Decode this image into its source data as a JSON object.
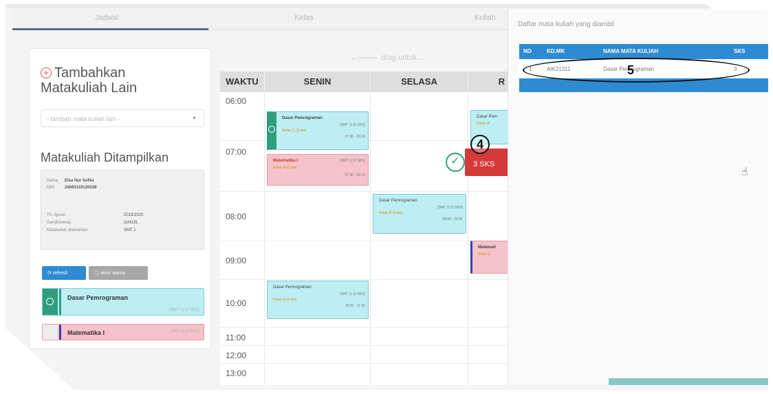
{
  "topbar": {
    "tabs": [
      "Jadwal",
      "Kelas",
      "Kuliah"
    ]
  },
  "left_panel": {
    "add_title": "Tambahkan Matakuliah Lain",
    "select_placeholder": "- tambah mata kuliah lain -",
    "shown_title": "Matakuliah Ditampilkan",
    "info": [
      {
        "label": "Nama",
        "value": "Elsa Nur Sefita"
      },
      {
        "label": "NIM",
        "value": "24060119120038"
      },
      {
        "label": "Th. Ajaran",
        "value": "2019/2020"
      },
      {
        "label": "Ganjil/Genap",
        "value": "GANJIL"
      },
      {
        "label": "Matakuliah ditawarkan",
        "value": "SMT 1"
      }
    ],
    "refresh_label": "refresh",
    "reset_label": "reset warna",
    "cards": [
      {
        "name": "Dasar Pemrograman",
        "meta": "(SMT 1) (3 SKS)"
      },
      {
        "name": "Matematika I",
        "meta": "(SMT 1) (2 SKS)"
      }
    ]
  },
  "schedule": {
    "drag_hint": "drag untuk ...",
    "headers": [
      "WAKTU",
      "SENIN",
      "SELASA"
    ],
    "times": [
      "06:00",
      "07:00",
      "08:00",
      "09:00",
      "10:00",
      "11:00",
      "12:00",
      "13:00"
    ],
    "events": [
      {
        "title": "Dasar Pemrograman",
        "smt": "(SMT 1) (3 SKS)",
        "kelas": "Kelas: C (3 sks)",
        "hours": "07:00 - 09:30"
      },
      {
        "title": "Matematika I",
        "smt": "(SMT 1) (2 SKS)",
        "kelas": "Kelas: A (2 sks)",
        "hours": "07:30 - 09:10"
      },
      {
        "title": "Dasar Pemrograman",
        "smt": "(SMT 1) (3 SKS)",
        "kelas": "Kelas: B (3 sks)",
        "hours": "08:00 - 09:30"
      },
      {
        "title": "Dasar Pemrograman",
        "smt": "(SMT 1) (3 SKS)",
        "kelas": "Kelas: A (3 sks)",
        "hours": "10:00 - 11:30"
      },
      {
        "title": "Dasar Pem",
        "kelas": "Kelas: A",
        "smt": "",
        "hours": ""
      },
      {
        "title": "Matemati",
        "kelas": "Kelas: C",
        "smt": "",
        "hours": ""
      }
    ],
    "drag_chip": "3 SKS",
    "annotation_4": "4"
  },
  "right_panel": {
    "title": "Daftar mata kuliah yang diambil",
    "columns": [
      "NO",
      "KD.MK",
      "NAMA MATA KULIAH",
      "SKS"
    ],
    "rows": [
      {
        "no": "1",
        "kd": "AIK21311",
        "nama": "Dasar Pemrograman",
        "sks": "3"
      }
    ],
    "annotation_5": "5"
  },
  "colors": {
    "accent": "#2e8bd1",
    "cyan": "#bdeef3",
    "pink": "#f6c2cb",
    "red": "#d43a3a",
    "green": "#2f9e7e"
  }
}
